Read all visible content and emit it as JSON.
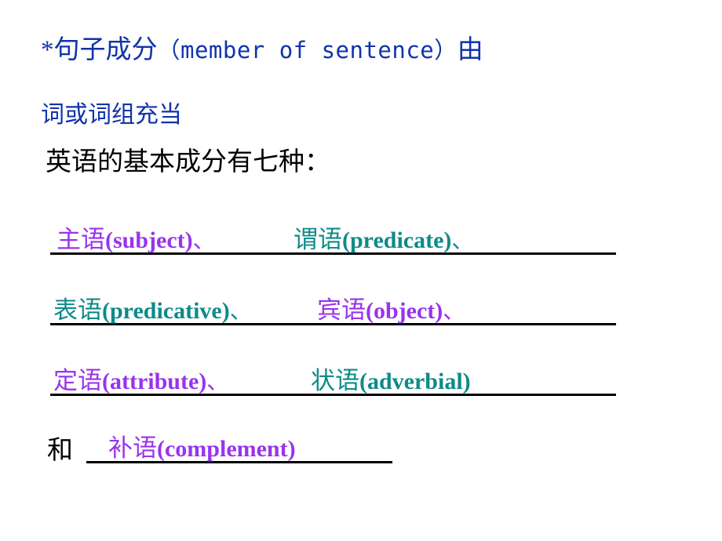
{
  "slide": {
    "background_color": "#ffffff",
    "intro": {
      "line1_prefix": "*句子成分",
      "line1_english": "（member of sentence）",
      "line1_suffix": "由",
      "line2": "词或词组充当",
      "color": "#1133aa"
    },
    "heading": {
      "text": "英语的基本成分有七种：",
      "color": "#000000"
    },
    "colors": {
      "purple": "#9933ee",
      "teal": "#0e8b88",
      "blue": "#1133aa",
      "black": "#000000",
      "rule": "#000000"
    },
    "rows": [
      {
        "terms": [
          {
            "cn": "主语",
            "en": "(subject)",
            "sep": "、",
            "color": "#9933ee"
          },
          {
            "cn": "谓语",
            "en": "(predicate)",
            "sep": "、",
            "color": "#0e8b88"
          }
        ]
      },
      {
        "terms": [
          {
            "cn": "表语",
            "en": "(predicative)",
            "sep": "、",
            "color": "#0e8b88"
          },
          {
            "cn": "宾语",
            "en": "(object)",
            "sep": "、",
            "color": "#9933ee"
          }
        ]
      },
      {
        "terms": [
          {
            "cn": "定语",
            "en": "(attribute)",
            "sep": "、",
            "color": "#9933ee"
          },
          {
            "cn": "状语",
            "en": "(adverbial)",
            "sep": "",
            "color": "#0e8b88"
          }
        ]
      },
      {
        "lead": "和",
        "terms": [
          {
            "cn": "补语",
            "en": "(complement)",
            "sep": "",
            "color": "#9933ee"
          }
        ]
      }
    ]
  }
}
